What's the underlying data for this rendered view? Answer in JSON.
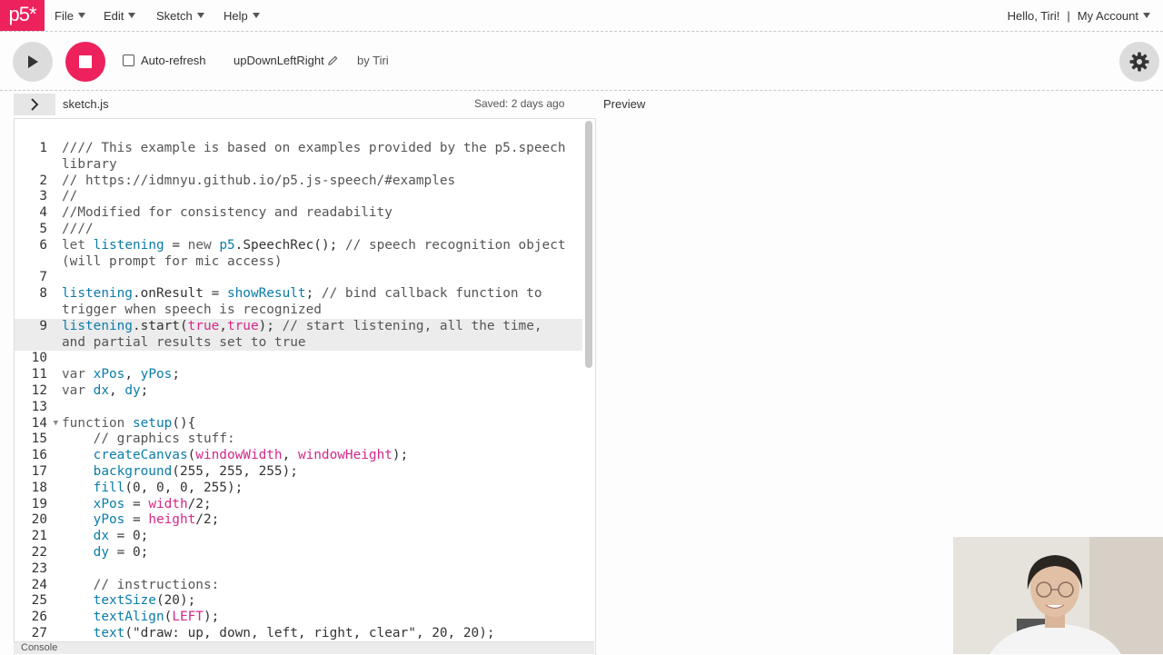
{
  "nav": {
    "logo": "p5*",
    "menus": [
      {
        "label": "File"
      },
      {
        "label": "Edit"
      },
      {
        "label": "Sketch"
      },
      {
        "label": "Help"
      }
    ],
    "greeting": "Hello, Tiri!",
    "separator": "|",
    "account": "My Account"
  },
  "toolbar": {
    "auto_refresh_label": "Auto-refresh",
    "auto_refresh_checked": false,
    "sketch_name": "upDownLeftRight",
    "by_line": "by Tiri"
  },
  "editor": {
    "file_name": "sketch.js",
    "saved_status": "Saved: 2 days ago",
    "preview_label": "Preview",
    "console_label": "Console",
    "active_line": 9
  },
  "code_lines": [
    {
      "n": "1",
      "text": "//// This example is based on examples provided by the p5.speech library"
    },
    {
      "n": "2",
      "text": "// https://idmnyu.github.io/p5.js-speech/#examples"
    },
    {
      "n": "3",
      "text": "//"
    },
    {
      "n": "4",
      "text": "//Modified for consistency and readability"
    },
    {
      "n": "5",
      "text": "////"
    },
    {
      "n": "6",
      "text": "let listening = new p5.SpeechRec(); // speech recognition object (will prompt for mic access)"
    },
    {
      "n": "7",
      "text": ""
    },
    {
      "n": "8",
      "text": "listening.onResult = showResult; // bind callback function to trigger when speech is recognized"
    },
    {
      "n": "9",
      "text": "listening.start(true,true); // start listening, all the time, and partial results set to true"
    },
    {
      "n": "10",
      "text": ""
    },
    {
      "n": "11",
      "text": "var xPos, yPos;"
    },
    {
      "n": "12",
      "text": "var dx, dy;"
    },
    {
      "n": "13",
      "text": ""
    },
    {
      "n": "14",
      "text": "function setup(){"
    },
    {
      "n": "15",
      "text": "    // graphics stuff:"
    },
    {
      "n": "16",
      "text": "    createCanvas(windowWidth, windowHeight);"
    },
    {
      "n": "17",
      "text": "    background(255, 255, 255);"
    },
    {
      "n": "18",
      "text": "    fill(0, 0, 0, 255);"
    },
    {
      "n": "19",
      "text": "    xPos = width/2;"
    },
    {
      "n": "20",
      "text": "    yPos = height/2;"
    },
    {
      "n": "21",
      "text": "    dx = 0;"
    },
    {
      "n": "22",
      "text": "    dy = 0;"
    },
    {
      "n": "23",
      "text": ""
    },
    {
      "n": "24",
      "text": "    // instructions:"
    },
    {
      "n": "25",
      "text": "    textSize(20);"
    },
    {
      "n": "26",
      "text": "    textAlign(LEFT);"
    },
    {
      "n": "27",
      "text": "    text(\"draw: up, down, left, right, clear\", 20, 20);"
    }
  ],
  "colors": {
    "brand": "#ed225d",
    "keyword_blue": "#0b7ca9",
    "constant_pink": "#d52889"
  },
  "icons": {
    "play": "play-icon",
    "stop": "stop-icon",
    "pencil": "pencil-icon",
    "gear": "gear-icon",
    "chevron": "chevron-right-icon",
    "caret": "chevron-down-icon"
  }
}
